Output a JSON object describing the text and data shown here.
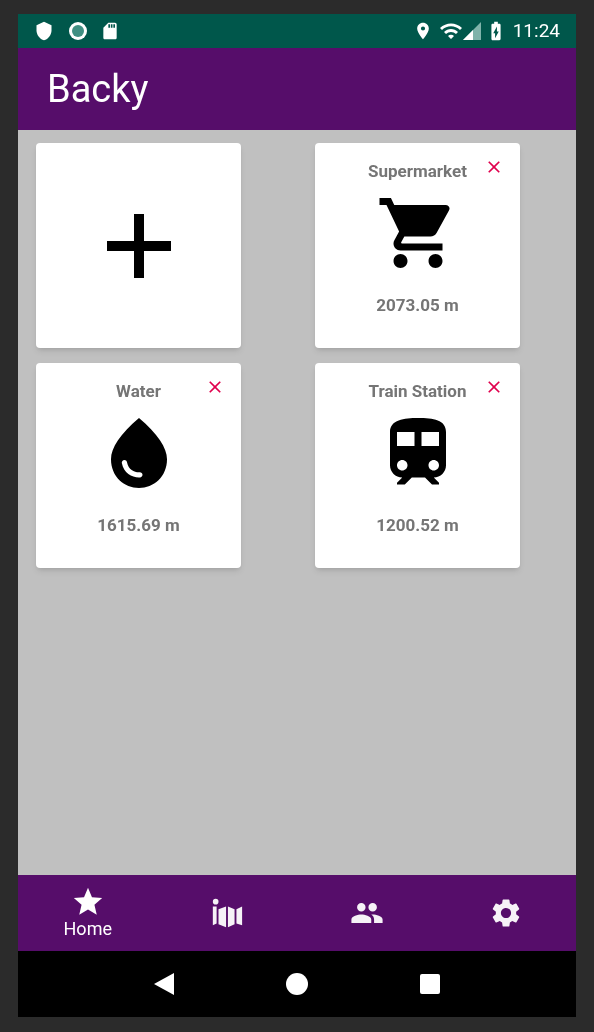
{
  "status_bar": {
    "time": "11:24"
  },
  "app_bar": {
    "title": "Backy"
  },
  "cards": [
    {
      "kind": "add"
    },
    {
      "kind": "place",
      "title": "Supermarket",
      "distance": "2073.05 m"
    },
    {
      "kind": "place",
      "title": "Water",
      "distance": "1615.69 m"
    },
    {
      "kind": "place",
      "title": "Train Station",
      "distance": "1200.52 m"
    }
  ],
  "bottom_nav": [
    {
      "label": "Home",
      "selected": true
    },
    {
      "selected": false
    },
    {
      "selected": false
    },
    {
      "selected": false
    }
  ]
}
